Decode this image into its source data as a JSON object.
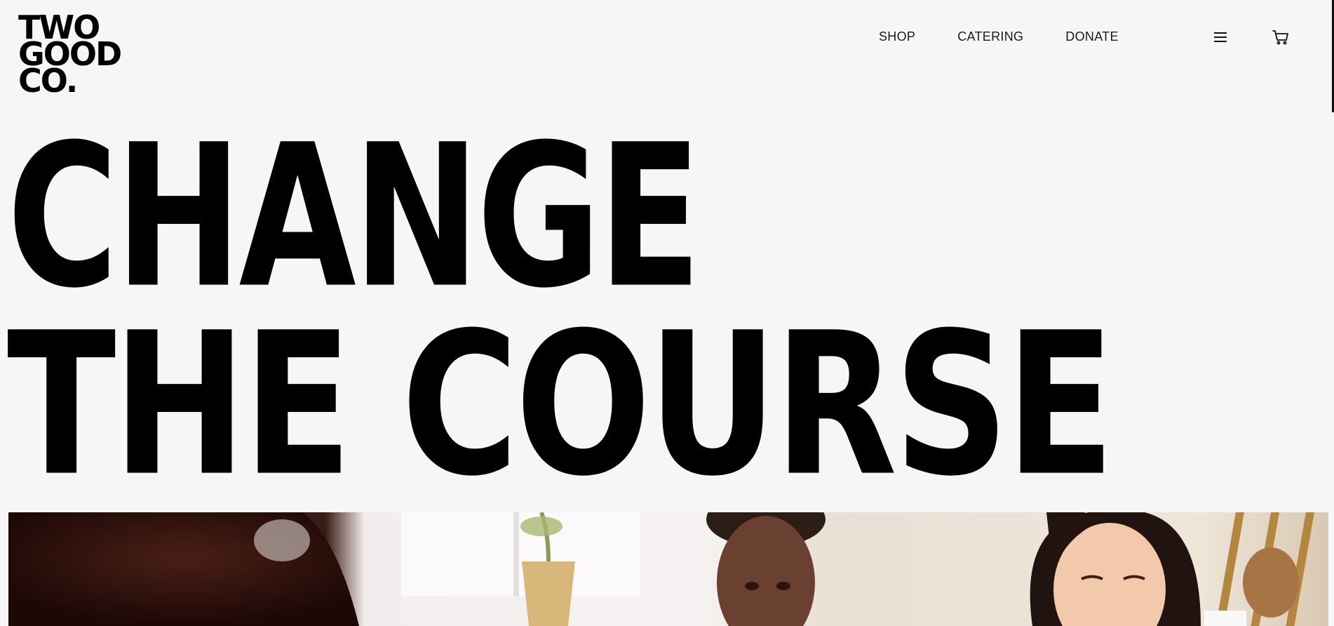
{
  "logo": {
    "lines": [
      "TWO",
      "GOOD",
      "CO."
    ]
  },
  "nav": {
    "items": [
      {
        "label": "SHOP"
      },
      {
        "label": "CATERING"
      },
      {
        "label": "DONATE"
      }
    ]
  },
  "header": {
    "menu_icon": "hamburger-menu-icon",
    "cart_icon": "shopping-cart-icon"
  },
  "hero": {
    "line1": "CHANGE",
    "line2": "THE COURSE"
  },
  "colors": {
    "background": "#f6f6f6",
    "text": "#000000"
  }
}
